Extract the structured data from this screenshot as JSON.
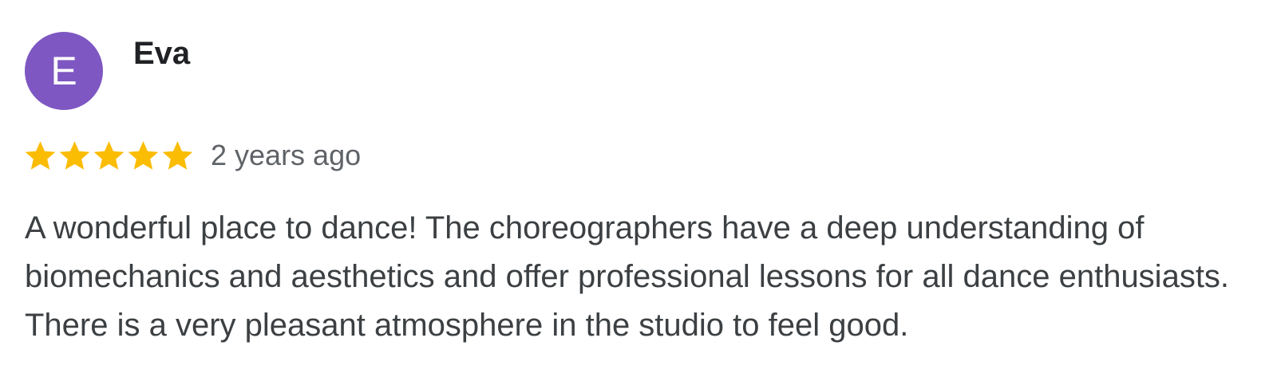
{
  "review": {
    "avatar": {
      "initial": "E",
      "color": "#7e57c2"
    },
    "author_name": "Eva",
    "rating": {
      "value": 5,
      "max": 5,
      "star_icon": "star-icon",
      "star_color": "#fbbc04"
    },
    "time_ago": "2 years ago",
    "text": "A wonderful place to dance! The choreographers have a deep understanding of biomechanics and aesthetics and offer professional lessons for all dance enthusiasts. There is a very pleasant atmosphere in the studio to feel good."
  }
}
